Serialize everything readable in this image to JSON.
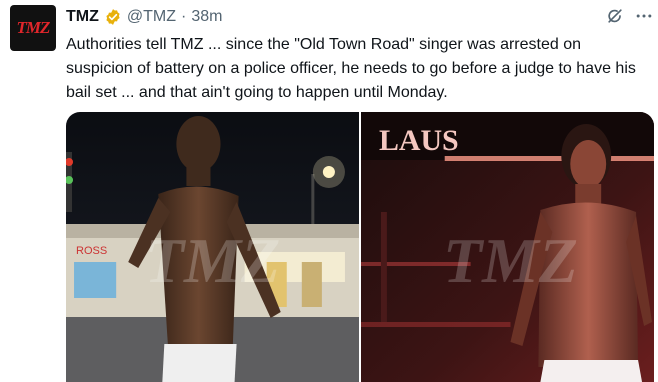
{
  "account": {
    "avatar_text": "TMZ",
    "display_name": "TMZ",
    "handle": "@TMZ",
    "separator": "·",
    "timestamp": "38m",
    "verified_icon": "verified-badge-icon",
    "verified_color": "#e8b10c"
  },
  "actions": {
    "grok_icon": "grok-icon",
    "more_icon": "more-icon"
  },
  "tweet": {
    "text": "Authorities tell TMZ ... since the \"Old Town Road\" singer was arrested on suspicion of battery on a police officer, he needs to go before a judge to have his bail set ... and that ain't going to happen until Monday."
  },
  "media": [
    {
      "watermark": "TMZ",
      "sign_text": "ROSS",
      "description_icon": "photo-icon"
    },
    {
      "watermark": "TMZ",
      "sign_text": "LAUS",
      "description_icon": "photo-icon"
    }
  ],
  "colors": {
    "text_primary": "#0f1419",
    "text_secondary": "#536471",
    "brand_red": "#e0262b"
  }
}
